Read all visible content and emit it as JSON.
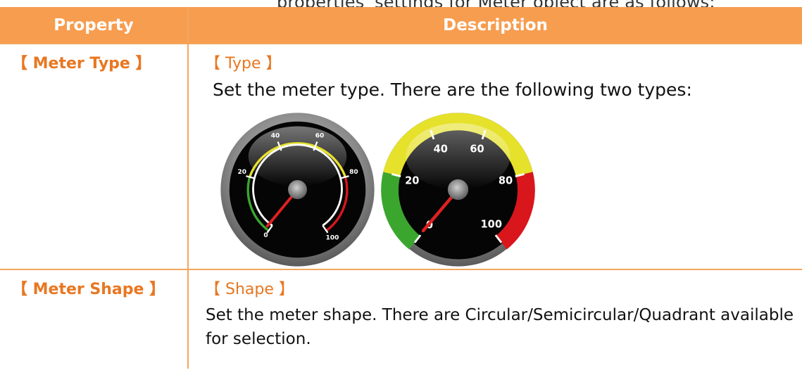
{
  "top_partial_line": "properties' settings for Meter object are as follows:",
  "table": {
    "headers": {
      "property": "Property",
      "description": "Description"
    },
    "rows": [
      {
        "property": "【 Meter Type 】",
        "field": "【 Type 】",
        "description": "Set the meter type. There are the following two types:",
        "meters": [
          {
            "style": "thin-arc",
            "ticks": [
              "0",
              "20",
              "40",
              "60",
              "80",
              "100"
            ]
          },
          {
            "style": "filled-band",
            "ticks": [
              "0",
              "20",
              "40",
              "60",
              "80",
              "100"
            ]
          }
        ]
      },
      {
        "property": "【 Meter Shape 】",
        "field": "【 Shape 】",
        "description": "Set the meter shape. There are Circular/Semicircular/Quadrant available for selection."
      }
    ]
  },
  "colors": {
    "header_bg": "#f79d4f",
    "header_text": "#ffffff",
    "label_orange": "#e87722",
    "border": "#f2a65a",
    "zone_green": "#3aa62e",
    "zone_yellow": "#e6e12a",
    "zone_red": "#d9161c"
  }
}
